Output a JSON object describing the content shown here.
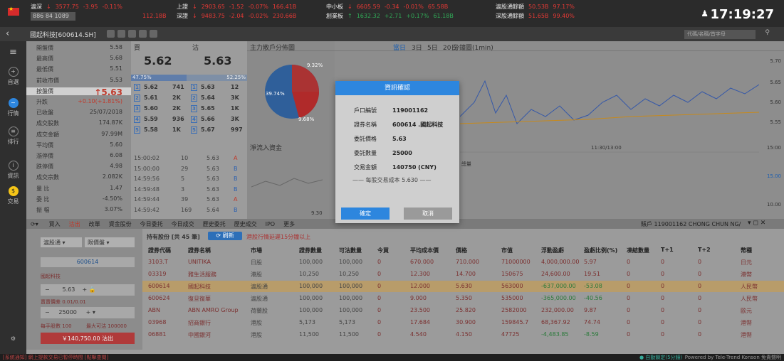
{
  "indices": [
    {
      "name": "滬深",
      "arrow": "↓",
      "value": "3577.75",
      "chg": "-3.95",
      "pct": "-0.11%",
      "line2": "886  84  1089"
    },
    {
      "name": "上證",
      "arrow": "↓",
      "value": "2903.65",
      "chg": "-1.52",
      "pct": "-0.07%",
      "amt": "166.41B",
      "line2": "112.18B"
    },
    {
      "name": "深證",
      "arrow": "↓",
      "value": "9483.75",
      "chg": "-2.04",
      "pct": "-0.02%",
      "amt": "230.66B"
    },
    {
      "name": "中小板",
      "arrow": "↓",
      "value": "6605.59",
      "chg": "-0.34",
      "pct": "-0.01%",
      "amt": "65.58B"
    },
    {
      "name": "創業板",
      "arrow": "↑",
      "value": "1632.32",
      "chg": "+2.71",
      "pct": "+0.17%",
      "amt": "61.18B"
    },
    {
      "name": "滬股通餘額",
      "value": "50.53B",
      "pct": "97.17%"
    },
    {
      "name": "深股通餘額",
      "value": "51.65B",
      "pct": "99.40%"
    }
  ],
  "clock": "17:19:27",
  "stock_title": "國起科技[600614.SH]",
  "search_placeholder": "代碼/名稱/首字母",
  "sidebar": [
    {
      "label": "自選",
      "icon": "+"
    },
    {
      "label": "行情",
      "icon": "~"
    },
    {
      "label": "排行",
      "icon": "≡"
    },
    {
      "label": "資訊",
      "icon": "i"
    },
    {
      "label": "交易",
      "icon": "$"
    }
  ],
  "quote_rows": [
    [
      "開盤價",
      "5.58"
    ],
    [
      "最高價",
      "5.68"
    ],
    [
      "最低價",
      "5.51"
    ],
    [
      "前收市價",
      "5.53"
    ],
    [
      "按盤價",
      "↑5.63"
    ],
    [
      "升跌",
      "+0.10(+1.81%)"
    ],
    [
      "已收盤",
      "25/07/2018"
    ],
    [
      "成交股數",
      "174.87K"
    ],
    [
      "成交金額",
      "97.99M"
    ],
    [
      "平均價",
      "5.60"
    ],
    [
      "漲停價",
      "6.08"
    ],
    [
      "跌停價",
      "4.98"
    ],
    [
      "成交宗數",
      "2.082K"
    ],
    [
      "量 比",
      "1.47"
    ],
    [
      "委 比",
      "-4.50%"
    ],
    [
      "振 幅",
      "3.07%"
    ]
  ],
  "book": {
    "buy_label": "買",
    "sell_label": "沽",
    "buy_price": "5.62",
    "sell_price": "5.63",
    "buy_pct": "47.75%",
    "sell_pct": "52.25%",
    "levels": [
      [
        "1",
        "5.62",
        "741",
        "1",
        "5.63",
        "12"
      ],
      [
        "2",
        "5.61",
        "2K",
        "2",
        "5.64",
        "3K"
      ],
      [
        "3",
        "5.60",
        "2K",
        "3",
        "5.65",
        "1K"
      ],
      [
        "4",
        "5.59",
        "936",
        "4",
        "5.66",
        "3K"
      ],
      [
        "5",
        "5.58",
        "1K",
        "5",
        "5.67",
        "997"
      ]
    ],
    "trades": [
      [
        "15:00:02",
        "10",
        "5.63",
        "A"
      ],
      [
        "15:00:00",
        "29",
        "5.63",
        "B"
      ],
      [
        "14:59:56",
        "5",
        "5.63",
        "B"
      ],
      [
        "14:59:48",
        "3",
        "5.63",
        "B"
      ],
      [
        "14:59:44",
        "39",
        "5.63",
        "A"
      ],
      [
        "14:59:42",
        "169",
        "5.64",
        "B"
      ]
    ]
  },
  "pie": {
    "title": "主力散戶分佈圖",
    "pct1": "9.32%",
    "pct2": "39.74%",
    "pct3": "9.68%",
    "flow_title": "淨流入資金",
    "extra": "9.30"
  },
  "chart": {
    "tabs": [
      "當日",
      "3日",
      "5日",
      "20日"
    ],
    "title": "分鐘圖(1min)",
    "y": [
      "5.70",
      "5.65",
      "5.60",
      "5.55",
      "15:00",
      "15.00",
      "10.00"
    ],
    "time": "11:30/13:00",
    "label": "總量"
  },
  "bottom_tabs": [
    "買入",
    "沽出",
    "改單",
    "資金股份",
    "今日委托",
    "今日成交",
    "歷史委托",
    "歷史成交",
    "IPO",
    "更多"
  ],
  "account": "賬戶 119001162 CHONG CHUN NG/",
  "order": {
    "market": "滬股通",
    "type": "限價盤",
    "code": "600614",
    "name": "國起科技",
    "price": "5.63",
    "step": "賣賣價差 0.01/0.01",
    "qty": "25000",
    "max_lbl": "每手股數 100",
    "max": "最大可沽 100000",
    "submit": "￥140,750.00 沽出"
  },
  "holdings": {
    "title": "持有股份 [共 45 筆]",
    "refresh": "刷新",
    "note": "港股行情延遲15分鐘以上",
    "cols": [
      "證券代碼",
      "證券名稱",
      "市場",
      "證券數量",
      "可沽數量",
      "今買",
      "平均成本價",
      "價格",
      "市值",
      "浮動盈虧",
      "盈虧比例(%)",
      "凍結數量",
      "T+1",
      "T+2",
      "幣種"
    ],
    "rows": [
      [
        "3103.T",
        "UNITIKA",
        "日股",
        "100,000",
        "100,000",
        "0",
        "670.000",
        "710.000",
        "71000000",
        "4,000,000.00",
        "5.97",
        "0",
        "0",
        "0",
        "日元"
      ],
      [
        "03319",
        "雅生活服務",
        "港股",
        "10,250",
        "10,250",
        "0",
        "12.300",
        "14.700",
        "150675",
        "24,600.00",
        "19.51",
        "0",
        "0",
        "0",
        "港幣"
      ],
      [
        "600614",
        "國起科技",
        "滬股通",
        "100,000",
        "100,000",
        "0",
        "12.000",
        "5.630",
        "563000",
        "-637,000.00",
        "-53.08",
        "0",
        "0",
        "0",
        "人民幣"
      ],
      [
        "600624",
        "復旦復華",
        "滬股通",
        "100,000",
        "100,000",
        "0",
        "9.000",
        "5.350",
        "535000",
        "-365,000.00",
        "-40.56",
        "0",
        "0",
        "0",
        "人民幣"
      ],
      [
        "ABN",
        "ABN AMRO Group",
        "荷蘭股",
        "100,000",
        "100,000",
        "0",
        "23.500",
        "25.820",
        "2582000",
        "232,000.00",
        "9.87",
        "0",
        "0",
        "0",
        "歐元"
      ],
      [
        "03968",
        "招商銀行",
        "港股",
        "5,173",
        "5,173",
        "0",
        "17.684",
        "30.900",
        "159845.7",
        "68,367.92",
        "74.74",
        "0",
        "0",
        "0",
        "港幣"
      ],
      [
        "06881",
        "中國銀河",
        "港股",
        "11,500",
        "11,500",
        "0",
        "4.540",
        "4.150",
        "47725",
        "-4,483.85",
        "-8.59",
        "0",
        "0",
        "0",
        "港幣"
      ]
    ]
  },
  "status": {
    "left": "[系統通知] 網上提款交易已暫停時間 [點擊查閱]",
    "mid": "● 自動鎖定(5分鐘)",
    "right": "Powered by Tele-Trend Konson  免責聲明"
  },
  "modal": {
    "title": "資訊確認",
    "rows": [
      [
        "戶口編號",
        "119001162"
      ],
      [
        "證券名稱",
        "600614 .國起科技"
      ],
      [
        "委託價格",
        "5.63"
      ],
      [
        "委託數量",
        "25000"
      ],
      [
        "交易金額",
        "140750 (CNY)"
      ]
    ],
    "note": "每股交易成本 5.630",
    "ok": "確定",
    "cancel": "取消"
  },
  "colors": {
    "accent": "#2d86de",
    "up": "#e53935",
    "down": "#31a957"
  }
}
